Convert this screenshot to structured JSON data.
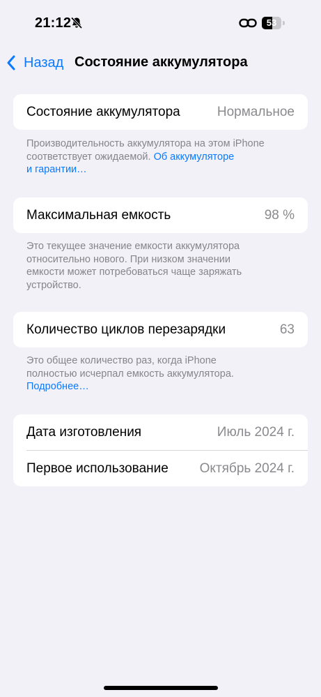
{
  "status_bar": {
    "time": "21:12",
    "battery_level": "53",
    "battery_fill_fraction": 0.53
  },
  "nav": {
    "back_label": "Назад",
    "title": "Состояние аккумулятора"
  },
  "battery_health": {
    "label": "Состояние аккумулятора",
    "value": "Нормальное",
    "footnote_line1": "Производительность аккумулятора на этом iPhone",
    "footnote_line2_text": "соответствует ожидаемой. ",
    "footnote_line2_link": "Об аккумуляторе",
    "footnote_line3_link": "и гарантии…"
  },
  "max_capacity": {
    "label": "Максимальная емкость",
    "value": "98 %",
    "footnote_lines": [
      "Это текущее значение емкости аккумулятора",
      "относительно нового. При низком значении",
      "емкости может потребоваться чаще заряжать",
      "устройство."
    ]
  },
  "cycle_count": {
    "label": "Количество циклов перезарядки",
    "value": "63",
    "footnote_line1": "Это общее количество раз, когда iPhone",
    "footnote_line2": "полностью исчерпал емкость аккумулятора.",
    "footnote_link": "Подробнее…"
  },
  "dates": {
    "manufacture_label": "Дата изготовления",
    "manufacture_value": "Июль 2024 г.",
    "first_use_label": "Первое использование",
    "first_use_value": "Октябрь 2024 г."
  },
  "colors": {
    "accent": "#0a7aff",
    "background": "#f2f1f7",
    "secondary_text": "#8a8a8e"
  }
}
